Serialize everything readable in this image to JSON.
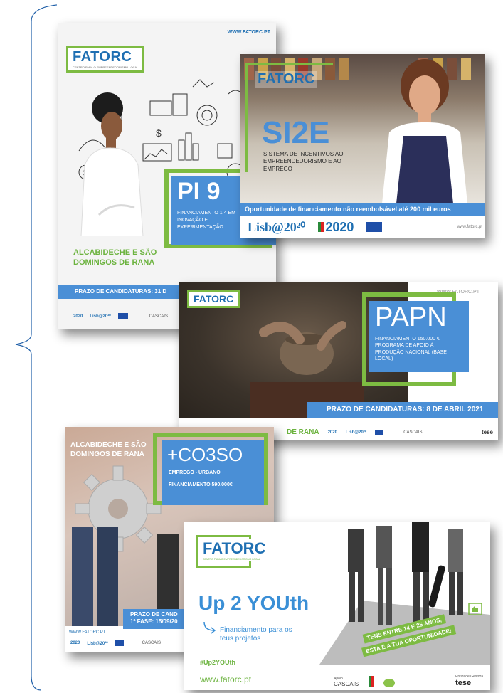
{
  "cards": {
    "pi9": {
      "url": "WWW.FATORC.PT",
      "logo": "FATORC",
      "logo_sub": "CENTRO PARA O EMPREENDEDORISMO LOCAL",
      "title": "PI 9",
      "desc": "FINANCIAMENTO 1.4 EM INOVAÇÃO E EXPERIMENTAÇÃO",
      "region": "ALCABIDECHE E SÃO DOMINGOS DE RANA",
      "deadline": "PRAZO DE CANDIDATURAS: 31 D",
      "footer": [
        "2020",
        "Lisb@20²⁰",
        "CASCAIS"
      ]
    },
    "si2e": {
      "logo": "FATORC",
      "title": "SI2E",
      "subtitle": "SISTEMA DE INCENTIVOS AO EMPREENDEDORISMO E AO EMPREGO",
      "banner": "Oportunidade de financiamento não reembolsável até 200 mil euros",
      "footer_lisboa": "Lisb@20²⁰",
      "footer_pt": "2020",
      "footer_url": "www.fatorc.pt"
    },
    "papn": {
      "url": "WWW.FATORC.PT",
      "logo": "FATORC",
      "title": "PAPN",
      "desc": "FINANCIAMENTO 150.000 € PROGRAMA DE APOIO À PRODUÇÃO NACIONAL (BASE LOCAL)",
      "deadline": "PRAZO DE CANDIDATURAS: 8 DE ABRIL 2021",
      "footer_region": "DE RANA",
      "footer": [
        "2020",
        "Lisb@20²⁰",
        "CASCAIS",
        "tese"
      ]
    },
    "coeso": {
      "region": "ALCABIDECHE E SÃO DOMINGOS DE RANA",
      "title": "+CO3SO",
      "line1": "EMPREGO - URBANO",
      "line2": "FINANCIAMENTO  590.000€",
      "deadline1": "PRAZO DE CAND",
      "deadline2": "1ª FASE: 15/09/20",
      "url": "WWW.FATORC.PT",
      "footer": [
        "2020",
        "Lisb@20²⁰",
        "CASCAIS"
      ]
    },
    "up2youth": {
      "logo": "FATORC",
      "logo_sub": "CENTRO PARA O EMPREENDEDORISMO LOCAL",
      "title": "Up 2 YOUth",
      "sub": "Financiamento para os teus projetos",
      "hashtag": "#Up2YOUth",
      "url": "www.fatorc.pt",
      "badge1": "TENS ENTRE 14 E 25 ANOS,",
      "badge2": "ESTA É A TUA OPORTUNIDADE!",
      "apoio": "Apoio",
      "gestora": "Entidade Gestora",
      "cascais": "CASCAIS",
      "tese": "tese"
    }
  },
  "colors": {
    "green": "#7dbb42",
    "blue": "#4a8fd6",
    "dark_blue": "#1f6fb2"
  }
}
